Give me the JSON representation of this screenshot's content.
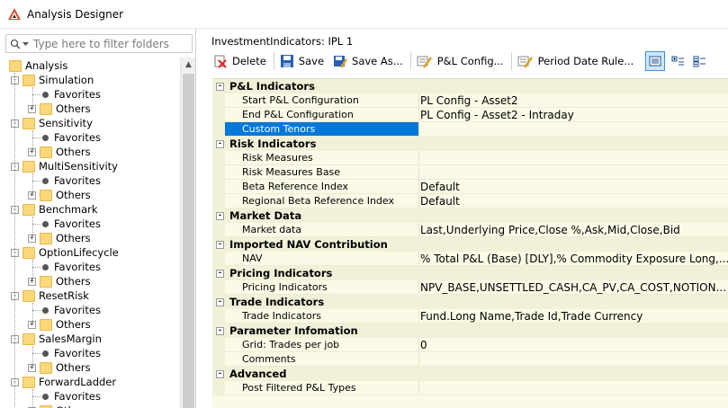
{
  "window": {
    "title": "Analysis Designer"
  },
  "filter": {
    "placeholder": "Type here to filter folders"
  },
  "tree": {
    "root": "Analysis",
    "folders": [
      {
        "label": "Simulation",
        "children": [
          "Favorites",
          "Others"
        ]
      },
      {
        "label": "Sensitivity",
        "children": [
          "Favorites",
          "Others"
        ]
      },
      {
        "label": "MultiSensitivity",
        "children": [
          "Favorites",
          "Others"
        ]
      },
      {
        "label": "Benchmark",
        "children": [
          "Favorites",
          "Others"
        ]
      },
      {
        "label": "OptionLifecycle",
        "children": [
          "Favorites",
          "Others"
        ]
      },
      {
        "label": "ResetRisk",
        "children": [
          "Favorites",
          "Others"
        ]
      },
      {
        "label": "SalesMargin",
        "children": [
          "Favorites",
          "Others"
        ]
      },
      {
        "label": "ForwardLadder",
        "children": [
          "Favorites",
          "Others"
        ]
      }
    ]
  },
  "doc": {
    "title": "InvestmentIndicators: IPL 1"
  },
  "toolbar": {
    "delete_label": "Delete",
    "save_label": "Save",
    "save_as_label": "Save As...",
    "pl_config_label": "P&L Config...",
    "period_date_rule_label": "Period Date Rule..."
  },
  "grid": {
    "categories": [
      {
        "name": "P&L Indicators",
        "props": [
          {
            "name": "Start P&L Configuration",
            "value": "PL Config - Asset2"
          },
          {
            "name": "End P&L Configuration",
            "value": "PL Config - Asset2 - Intraday"
          },
          {
            "name": "Custom Tenors",
            "value": "",
            "selected": true
          }
        ]
      },
      {
        "name": "Risk Indicators",
        "props": [
          {
            "name": "Risk Measures",
            "value": ""
          },
          {
            "name": "Risk Measures Base",
            "value": ""
          },
          {
            "name": "Beta Reference Index",
            "value": "Default"
          },
          {
            "name": "Regional Beta Reference Index",
            "value": "Default"
          }
        ]
      },
      {
        "name": "Market Data",
        "props": [
          {
            "name": "Market data",
            "value": "Last,Underlying Price,Close %,Ask,Mid,Close,Bid"
          }
        ]
      },
      {
        "name": "Imported NAV Contribution",
        "props": [
          {
            "name": "NAV",
            "value": "% Total P&L (Base) [DLY],% Commodity Exposure Long,..."
          }
        ]
      },
      {
        "name": "Pricing Indicators",
        "props": [
          {
            "name": "Pricing Indicators",
            "value": "NPV_BASE,UNSETTLED_CASH,CA_PV,CA_COST,NOTION..."
          }
        ]
      },
      {
        "name": "Trade Indicators",
        "props": [
          {
            "name": "Trade Indicators",
            "value": "Fund.Long Name,Trade Id,Trade Currency"
          }
        ]
      },
      {
        "name": "Parameter Infomation",
        "props": [
          {
            "name": "Grid: Trades per job",
            "value": "0"
          },
          {
            "name": "Comments",
            "value": ""
          }
        ]
      },
      {
        "name": "Advanced",
        "props": [
          {
            "name": "Post Filtered P&L Types",
            "value": ""
          }
        ]
      }
    ]
  },
  "colors": {
    "accent": "#0078d7",
    "grid_bg": "#fafae6",
    "folder": "#fbd97a"
  }
}
